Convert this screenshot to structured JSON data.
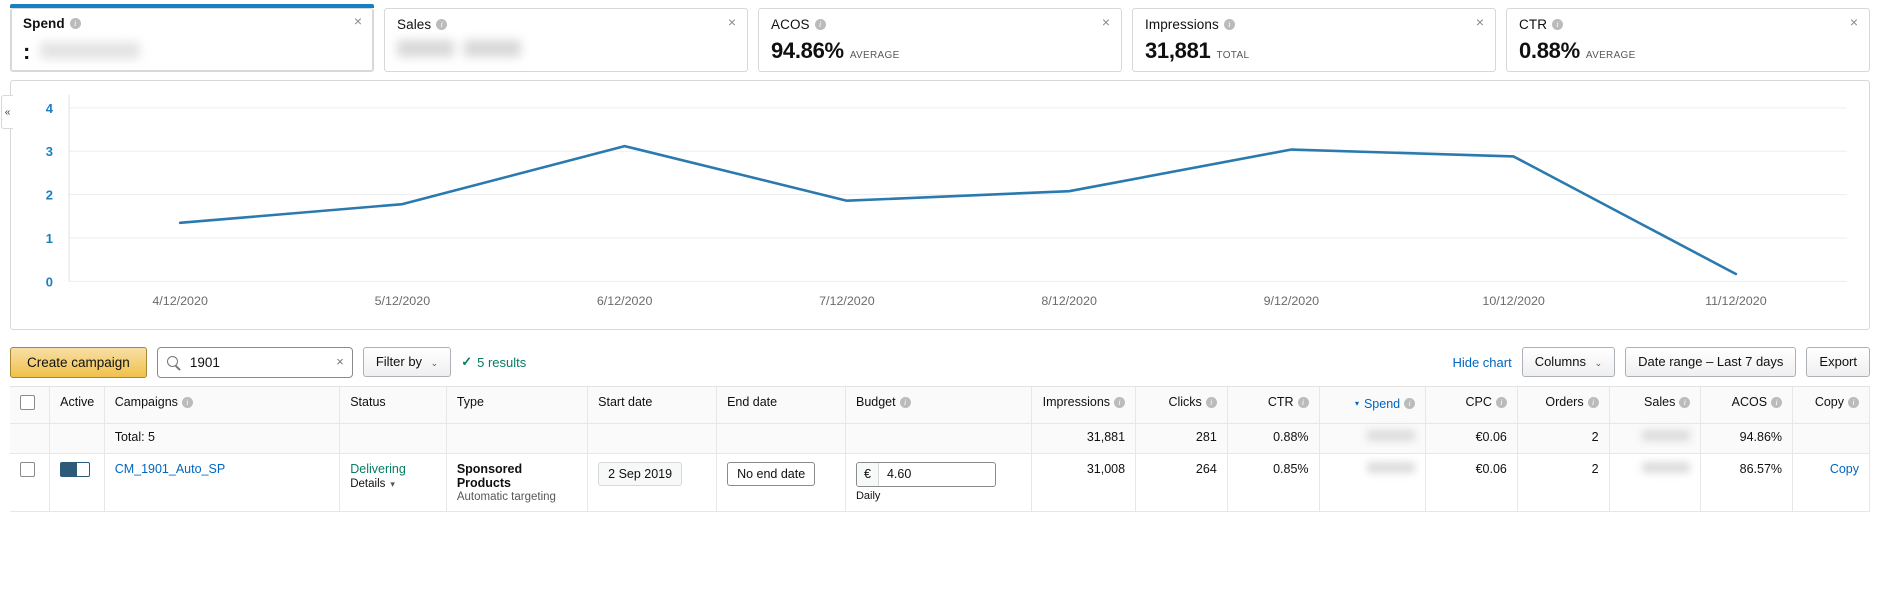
{
  "metric_cards": [
    {
      "title": "Spend",
      "value": null,
      "unit": null,
      "selected": true,
      "redacted": true,
      "close": "×"
    },
    {
      "title": "Sales",
      "value": null,
      "unit": null,
      "selected": false,
      "redacted": true,
      "close": "×"
    },
    {
      "title": "ACOS",
      "value": "94.86%",
      "unit": "AVERAGE",
      "selected": false,
      "redacted": false,
      "close": "×"
    },
    {
      "title": "Impressions",
      "value": "31,881",
      "unit": "TOTAL",
      "selected": false,
      "redacted": false,
      "close": "×"
    },
    {
      "title": "CTR",
      "value": "0.88%",
      "unit": "AVERAGE",
      "selected": false,
      "redacted": false,
      "close": "×"
    }
  ],
  "chart_collapse_handle": "«",
  "chart_data": {
    "type": "line",
    "title": "",
    "xlabel": "",
    "ylabel": "",
    "categories": [
      "4/12/2020",
      "5/12/2020",
      "6/12/2020",
      "7/12/2020",
      "8/12/2020",
      "9/12/2020",
      "10/12/2020",
      "11/12/2020"
    ],
    "series": [
      {
        "name": "Spend",
        "color": "#2a7aaf",
        "values": [
          1.35,
          1.78,
          3.12,
          1.86,
          2.08,
          3.04,
          2.88,
          0.17
        ]
      }
    ],
    "yticks": [
      0,
      1,
      2,
      3,
      4
    ],
    "ylim": [
      0,
      4.3
    ],
    "grid": true,
    "legend": "none",
    "tick_color": "#1a7fc1",
    "xtick_color": "#6b6b6b"
  },
  "toolbar": {
    "create_campaign": "Create campaign",
    "search_value": "1901",
    "search_placeholder": "",
    "search_clear": "×",
    "filter_by": "Filter by",
    "filter_caret": "⌄",
    "results_check": "✓",
    "results_text": "5 results",
    "hide_chart": "Hide chart",
    "columns": "Columns",
    "columns_caret": "⌄",
    "date_range": "Date range – Last 7 days",
    "export": "Export"
  },
  "table": {
    "columns": [
      {
        "label": "",
        "info": false,
        "align": "left",
        "sorted": false
      },
      {
        "label": "Active",
        "info": false,
        "align": "left",
        "sorted": false
      },
      {
        "label": "Campaigns",
        "info": true,
        "align": "left",
        "sorted": false
      },
      {
        "label": "Status",
        "info": false,
        "align": "left",
        "sorted": false
      },
      {
        "label": "Type",
        "info": false,
        "align": "left",
        "sorted": false
      },
      {
        "label": "Start date",
        "info": false,
        "align": "left",
        "sorted": false
      },
      {
        "label": "End date",
        "info": false,
        "align": "left",
        "sorted": false
      },
      {
        "label": "Budget",
        "info": true,
        "align": "left",
        "sorted": false
      },
      {
        "label": "Impressions",
        "info": true,
        "align": "right",
        "sorted": false
      },
      {
        "label": "Clicks",
        "info": true,
        "align": "right",
        "sorted": false
      },
      {
        "label": "CTR",
        "info": true,
        "align": "right",
        "sorted": false
      },
      {
        "label": "Spend",
        "info": true,
        "align": "right",
        "sorted": true
      },
      {
        "label": "CPC",
        "info": true,
        "align": "right",
        "sorted": false
      },
      {
        "label": "Orders",
        "info": true,
        "align": "right",
        "sorted": false
      },
      {
        "label": "Sales",
        "info": true,
        "align": "right",
        "sorted": false
      },
      {
        "label": "ACOS",
        "info": true,
        "align": "right",
        "sorted": false
      },
      {
        "label": "Copy",
        "info": true,
        "align": "right",
        "sorted": false
      }
    ],
    "sort_arrow": "▾",
    "total_row": {
      "label": "Total: 5",
      "impressions": "31,881",
      "clicks": "281",
      "ctr": "0.88%",
      "spend": null,
      "cpc": "€0.06",
      "orders": "2",
      "sales": null,
      "acos": "94.86%"
    },
    "rows": [
      {
        "campaign": "CM_1901_Auto_SP",
        "status": "Delivering",
        "details": "Details",
        "details_caret": "▾",
        "type_main": "Sponsored Products",
        "type_sub": "Automatic targeting",
        "start_date": "2 Sep 2019",
        "end_date": "No end date",
        "budget_currency": "€",
        "budget_value": "4.60",
        "budget_period": "Daily",
        "impressions": "31,008",
        "clicks": "264",
        "ctr": "0.85%",
        "spend": null,
        "cpc": "€0.06",
        "orders": "2",
        "sales": null,
        "acos": "86.57%",
        "copy": "Copy"
      }
    ]
  }
}
